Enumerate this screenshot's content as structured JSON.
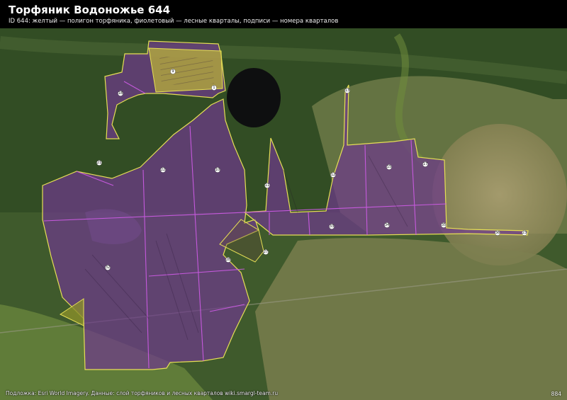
{
  "header": {
    "title": "Торфяник Водоножье 644",
    "subtitle": "ID 644: желтый — полигон торфяника, фиолетовый — лесные кварталы, подписи — номера кварталов"
  },
  "footer": {
    "attribution": "Подложка: Esri World Imagery. Данные: слой торфяников и лесных кварталов wiki.smargl-team.ru",
    "corner_code": "884"
  },
  "legend": {
    "peatland_color": "#e8e05a",
    "quarter_color": "#c84fe0",
    "peat_fill": "#6b2f86"
  },
  "quarter_labels": [
    "9",
    "1",
    "18",
    "21",
    "22",
    "10",
    "11",
    "12",
    "13",
    "15",
    "17",
    "33",
    "34",
    "35",
    "36",
    "23",
    "27",
    "28",
    "32"
  ]
}
